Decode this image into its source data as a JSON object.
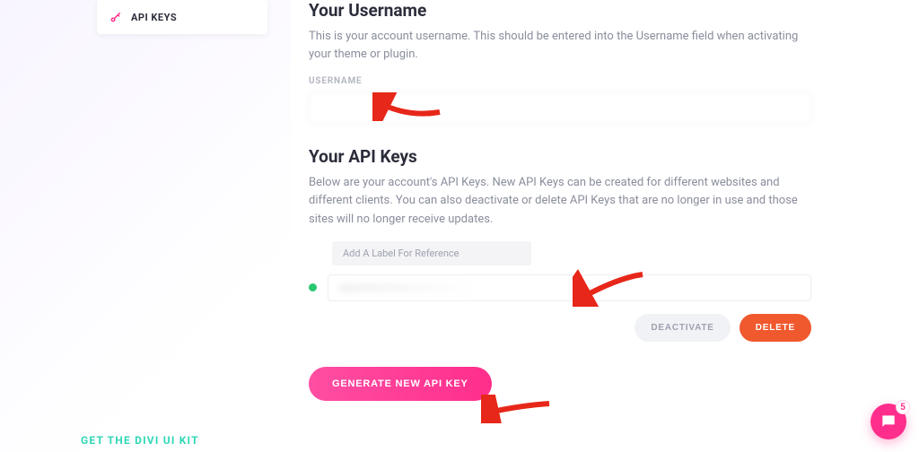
{
  "sidebar": {
    "nav_item_label": "API KEYS"
  },
  "username_section": {
    "heading": "Your Username",
    "description": "This is your account username. This should be entered into the Username field when activating your theme or plugin.",
    "field_label": "USERNAME",
    "value": ""
  },
  "api_keys_section": {
    "heading": "Your API Keys",
    "description": "Below are your account's API Keys. New API Keys can be created for different websites and different clients. You can also deactivate or delete API Keys that are no longer in use and those sites will no longer receive updates.",
    "label_placeholder": "Add A Label For Reference",
    "status": "active",
    "deactivate_label": "DEACTIVATE",
    "delete_label": "DELETE",
    "generate_label": "GENERATE NEW API KEY"
  },
  "promo_text": "GET THE DIVI UI KIT",
  "chat_badge_count": "5"
}
